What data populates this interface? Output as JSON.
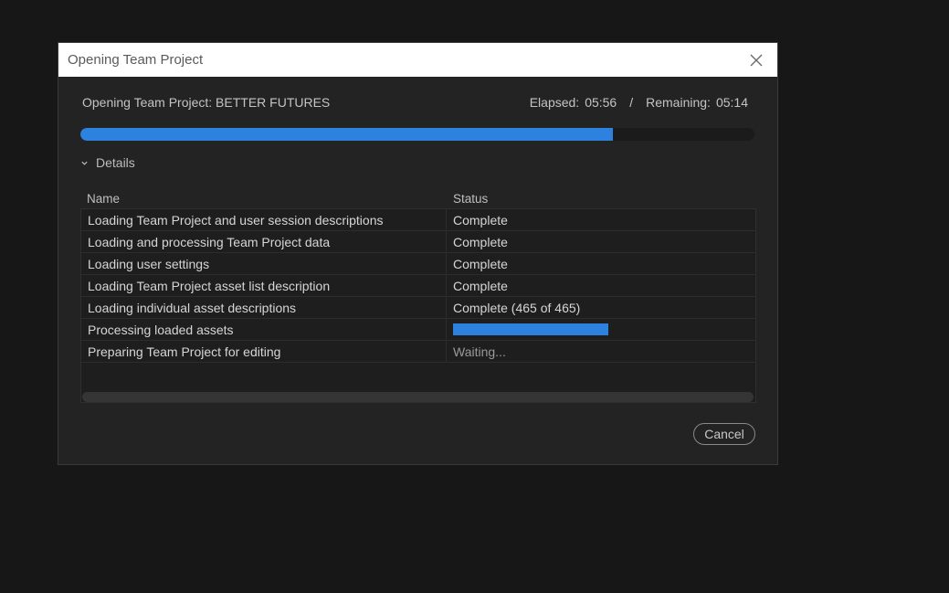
{
  "dialog": {
    "title": "Opening Team Project",
    "heading": "Opening Team Project: BETTER FUTURES",
    "elapsed_label": "Elapsed:",
    "elapsed_value": "05:56",
    "separator": "/",
    "remaining_label": "Remaining:",
    "remaining_value": "05:14",
    "overall_progress_percent": 79,
    "details_label": "Details",
    "cancel_label": "Cancel"
  },
  "table": {
    "columns": [
      "Name",
      "Status"
    ],
    "rows": [
      {
        "name": "Loading Team Project and user session descriptions",
        "status": "Complete"
      },
      {
        "name": "Loading and processing Team Project data",
        "status": "Complete"
      },
      {
        "name": "Loading user settings",
        "status": "Complete"
      },
      {
        "name": "Loading Team Project asset list description",
        "status": "Complete"
      },
      {
        "name": "Loading individual asset descriptions",
        "status": "Complete (465 of 465)"
      },
      {
        "name": "Processing loaded assets",
        "status": "",
        "progress_percent": 100
      },
      {
        "name": "Preparing Team Project for editing",
        "status": "Waiting..."
      }
    ]
  },
  "colors": {
    "accent": "#2d82e0",
    "background": "#171717",
    "dialog": "#232323"
  }
}
